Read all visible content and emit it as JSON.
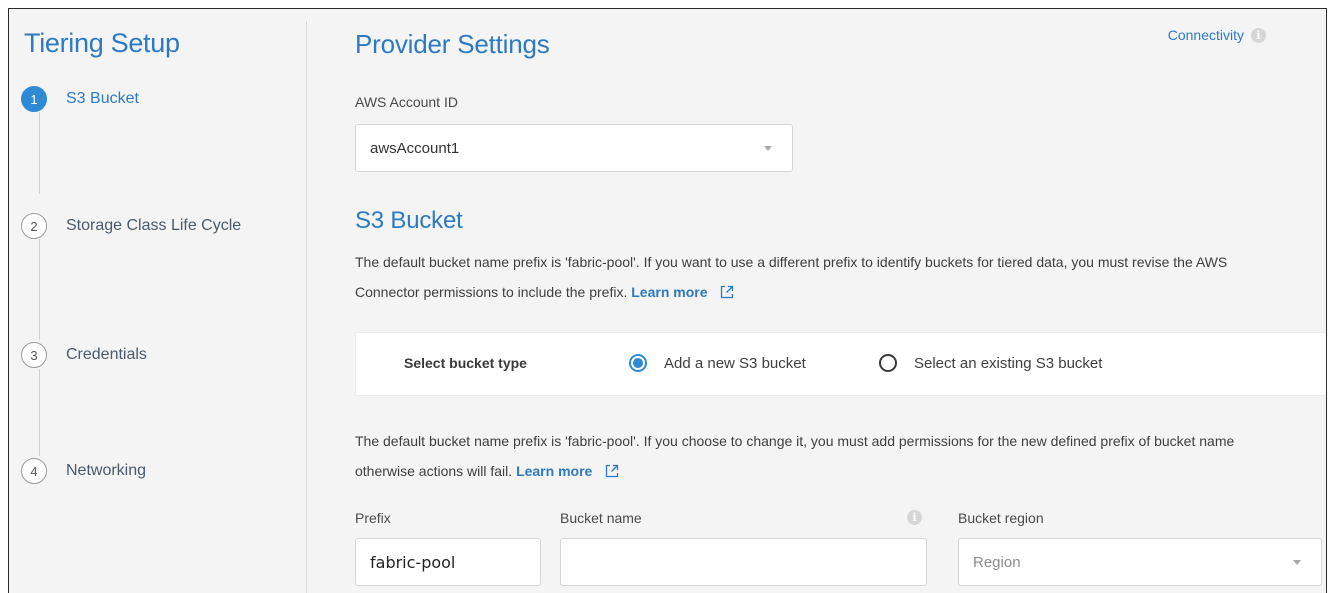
{
  "sidebar": {
    "title": "Tiering Setup",
    "steps": [
      {
        "number": "1",
        "label": "S3 Bucket"
      },
      {
        "number": "2",
        "label": "Storage Class Life Cycle"
      },
      {
        "number": "3",
        "label": "Credentials"
      },
      {
        "number": "4",
        "label": "Networking"
      }
    ]
  },
  "main": {
    "title": "Provider Settings",
    "connectivity_label": "Connectivity",
    "info_symbol": "i",
    "aws_account": {
      "label": "AWS Account ID",
      "value": "awsAccount1"
    },
    "s3_section": {
      "title": "S3 Bucket",
      "description": "The default bucket name prefix is 'fabric-pool'. If you want to use a different prefix to identify buckets for tiered data, you must revise the AWS Connector permissions to include the prefix.",
      "learn_more": "Learn more"
    },
    "bucket_type": {
      "label": "Select bucket type",
      "options": [
        {
          "label": "Add a new S3 bucket",
          "selected": true
        },
        {
          "label": "Select an existing S3 bucket",
          "selected": false
        }
      ]
    },
    "prefix_note": {
      "text": "The default bucket name prefix is 'fabric-pool'. If you choose to change it, you must add permissions for the new defined prefix of bucket name otherwise actions will fail.",
      "learn_more": "Learn more"
    },
    "fields": {
      "prefix": {
        "label": "Prefix",
        "value": "fabric-pool"
      },
      "bucket_name": {
        "label": "Bucket name",
        "value": ""
      },
      "bucket_region": {
        "label": "Bucket region",
        "placeholder": "Region"
      }
    }
  },
  "colors": {
    "accent": "#2e7ac2",
    "active_step": "#2f8ad6",
    "background": "#f4f4f4"
  },
  "icons": [
    "chevron-down-icon",
    "info-icon",
    "external-link-icon"
  ]
}
